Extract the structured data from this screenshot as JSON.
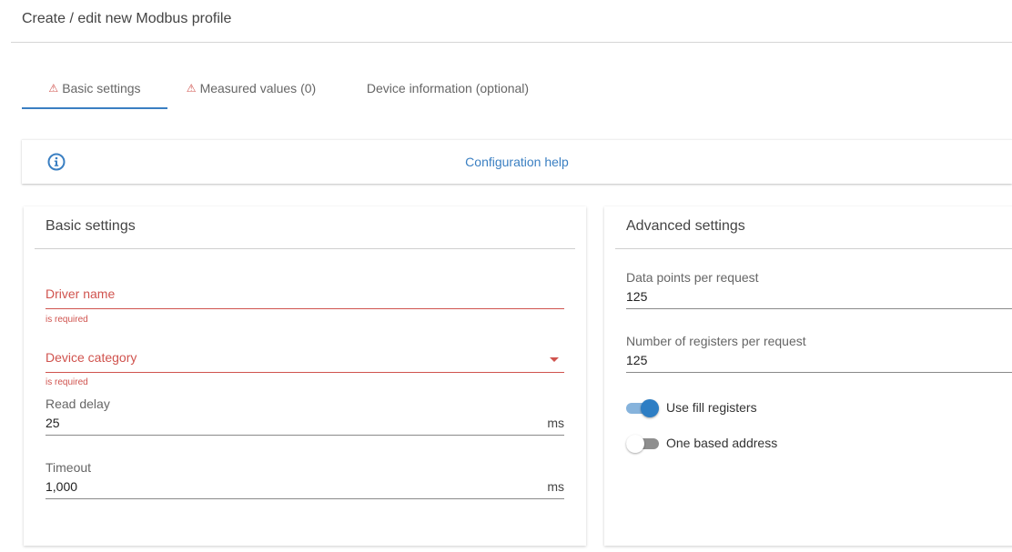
{
  "page": {
    "title": "Create / edit new Modbus profile"
  },
  "tabs": [
    {
      "label": "Basic settings",
      "warning": "⚠",
      "active": true
    },
    {
      "label": "Measured values (0)",
      "warning": "⚠",
      "active": false
    },
    {
      "label": "Device information (optional)",
      "warning": "",
      "active": false
    }
  ],
  "help": {
    "icon": "info-icon",
    "link_text": "Configuration help"
  },
  "basic": {
    "title": "Basic settings",
    "driver_name": {
      "label": "Driver name",
      "value": "",
      "error": "is required"
    },
    "device_category": {
      "label": "Device category",
      "value": "",
      "error": "is required",
      "icon": "dropdown-arrow-icon"
    },
    "read_delay": {
      "label": "Read delay",
      "value": "25",
      "unit": "ms"
    },
    "timeout": {
      "label": "Timeout",
      "value": "1,000",
      "unit": "ms"
    }
  },
  "advanced": {
    "title": "Advanced settings",
    "data_points": {
      "label": "Data points per request",
      "value": "125"
    },
    "registers": {
      "label": "Number of registers per request",
      "value": "125"
    },
    "use_fill_registers": {
      "label": "Use fill registers",
      "checked": true
    },
    "one_based_address": {
      "label": "One based address",
      "checked": false
    }
  },
  "colors": {
    "accent": "#3a7fc2",
    "error": "#d0534e",
    "toggle_on_track": "#86b3dc",
    "toggle_on_thumb": "#2e7ec4",
    "toggle_off_track": "#8e8e8e",
    "toggle_off_thumb": "#ffffff"
  }
}
